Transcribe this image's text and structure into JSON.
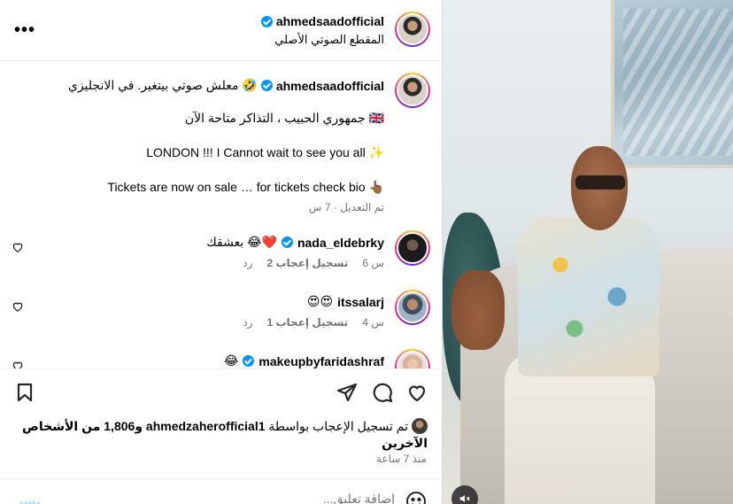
{
  "header": {
    "username": "ahmedsaadofficial",
    "audio": "المقطع الصوتي الأصلي"
  },
  "caption": {
    "username": "ahmedsaadofficial",
    "line1": "معلش صوتي بيتغير. في الانجليزي 🤣",
    "line2": "جمهوري الحبيب ، التذاكر متاحة الآن 🇬🇧",
    "line3": "LONDON !!! I Cannot wait to see you all ✨",
    "line4": "Tickets are now on sale … for tickets check bio 👆🏾",
    "meta": "تم التعديل · 7 س"
  },
  "comments": [
    {
      "username": "nada_eldebrky",
      "verified": true,
      "text": "بعشقك 😂❤️",
      "time": "6 س",
      "likes": "2 تسجيل إعجاب",
      "reply": "رد"
    },
    {
      "username": "itssalarj",
      "verified": false,
      "text": "😍😍",
      "time": "4 س",
      "likes": "1 تسجيل إعجاب",
      "reply": "رد"
    },
    {
      "username": "makeupbyfaridashraf",
      "verified": true,
      "text": "😂",
      "time": "",
      "likes": "",
      "reply": ""
    }
  ],
  "likes": {
    "prefix": "تم تسجيل الإعجاب بواسطة",
    "user": "ahmedzaherofficial1",
    "and": "و",
    "count": "1,806 من الأشخاص الآخرين"
  },
  "time_ago": "منذ 7 ساعة",
  "comment_box": {
    "placeholder": "إضافة تعليق...",
    "post_label": "نشر"
  },
  "colors": {
    "verified": "#0095f6",
    "secondary_text": "#737373",
    "post_disabled": "#b2dffc"
  }
}
